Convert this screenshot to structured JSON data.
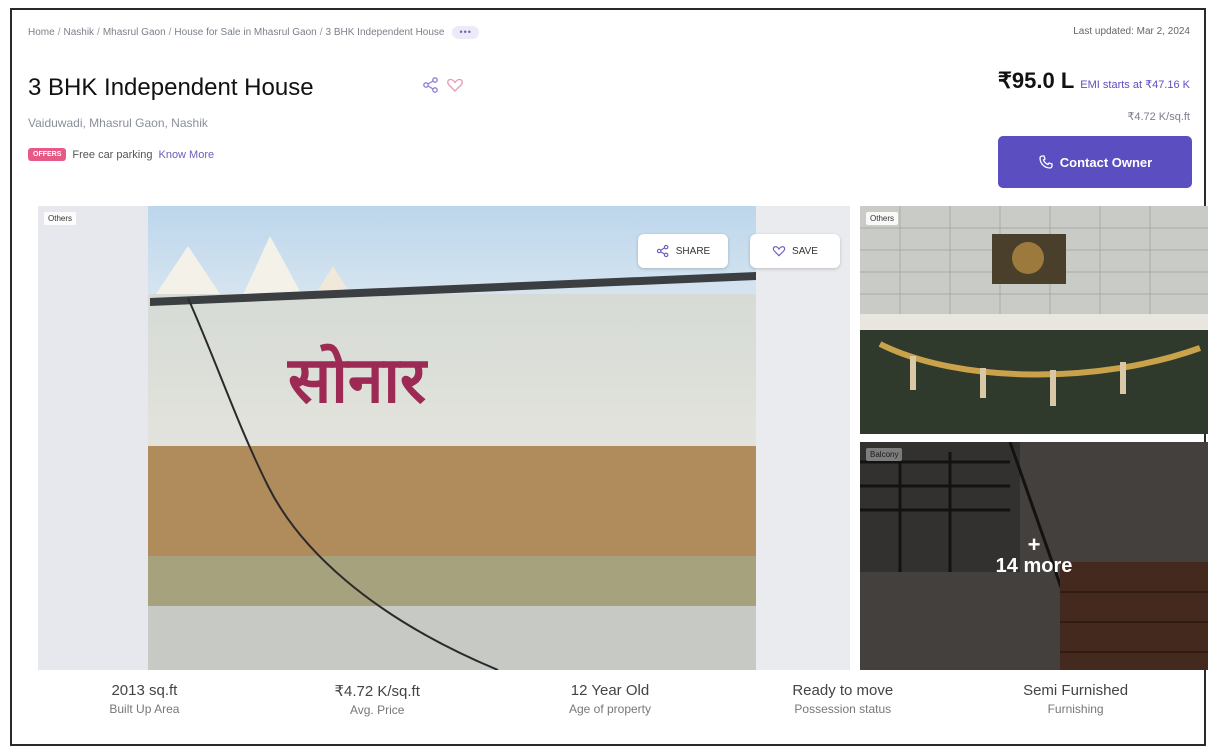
{
  "breadcrumb": {
    "items": [
      "Home",
      "Nashik",
      "Mhasrul Gaon",
      "House for Sale in Mhasrul Gaon",
      "3 BHK Independent House"
    ],
    "more": "•••"
  },
  "last_updated": "Last updated: Mar 2, 2024",
  "title": "3 BHK Independent House",
  "location": "Vaiduwadi, Mhasrul Gaon, Nashik",
  "price": "₹95.0 L",
  "emi": "EMI starts at ₹47.16 K",
  "price_per_sqft": "₹4.72 K/sq.ft",
  "offers": {
    "badge": "OFFERS",
    "text": "Free car parking",
    "link": "Know More"
  },
  "contact_button": "Contact Owner",
  "gallery": {
    "main_tag": "Others",
    "share_label": "SHARE",
    "save_label": "SAVE",
    "sign_text": "सोनार",
    "side1_tag": "Others",
    "side2_tag": "Balcony",
    "more_plus": "+",
    "more_text": "14 more"
  },
  "stats": [
    {
      "value": "2013 sq.ft",
      "label": "Built Up Area"
    },
    {
      "value": "₹4.72 K/sq.ft",
      "label": "Avg. Price"
    },
    {
      "value": "12 Year Old",
      "label": "Age of property"
    },
    {
      "value": "Ready to move",
      "label": "Possession status"
    },
    {
      "value": "Semi Furnished",
      "label": "Furnishing"
    }
  ],
  "colors": {
    "accent": "#5a4ec0",
    "offers_badge": "#e85a86",
    "link": "#6a5fbf"
  }
}
